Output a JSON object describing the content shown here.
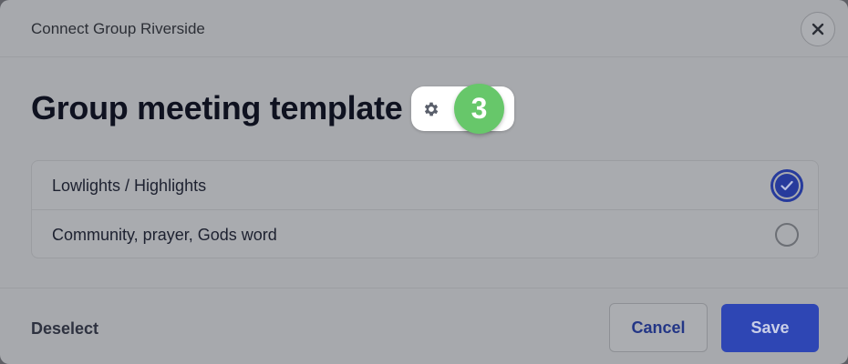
{
  "modal": {
    "title": "Connect Group Riverside",
    "heading": "Group meeting template",
    "step_badge": "3",
    "close_icon": "close-icon",
    "settings_icon": "gear-icon"
  },
  "options": [
    {
      "label": "Lowlights / Highlights",
      "selected": true
    },
    {
      "label": "Community, prayer, Gods word",
      "selected": false
    }
  ],
  "footer": {
    "deselect_label": "Deselect",
    "cancel_label": "Cancel",
    "save_label": "Save"
  },
  "colors": {
    "accent": "#2e46b4",
    "step_badge": "#67c76a"
  }
}
